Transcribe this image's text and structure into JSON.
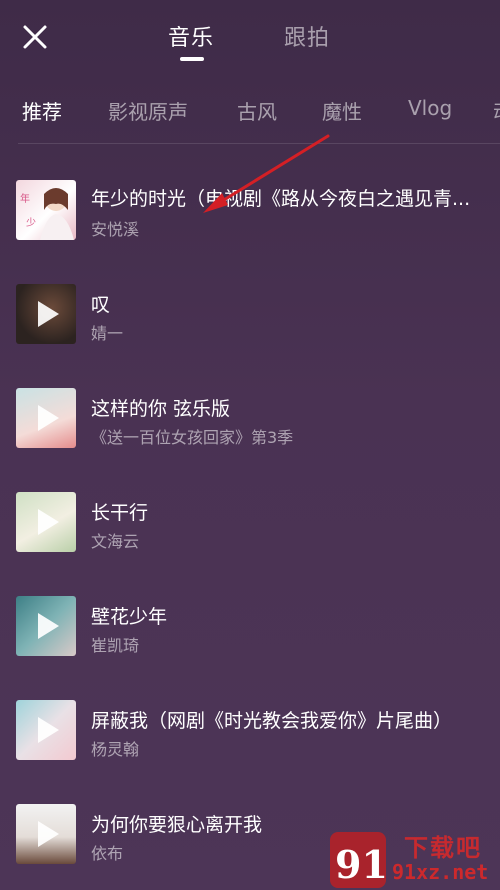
{
  "header": {
    "tabs": [
      {
        "label": "音乐",
        "active": true
      },
      {
        "label": "跟拍",
        "active": false
      }
    ]
  },
  "categories": [
    "推荐",
    "影视原声",
    "古风",
    "魔性",
    "Vlog",
    "动"
  ],
  "songs": [
    {
      "title": "年少的时光（电视剧《路从今夜白之遇见青...",
      "artist": "安悦溪",
      "thumb_colors": [
        "#f3d7de",
        "#ffffff"
      ],
      "play": false
    },
    {
      "title": "叹",
      "artist": "婧一",
      "thumb_colors": [
        "#2c2320",
        "#6b4a3a"
      ],
      "play": true
    },
    {
      "title": "这样的你 弦乐版",
      "artist": "《送一百位女孩回家》第3季",
      "thumb_colors": [
        "#c9e2e4",
        "#e58c8c"
      ],
      "play": true
    },
    {
      "title": "长干行",
      "artist": "文海云",
      "thumb_colors": [
        "#cfe0c4",
        "#f2efe2"
      ],
      "play": true
    },
    {
      "title": "壁花少年",
      "artist": "崔凯琦",
      "thumb_colors": [
        "#3d7f86",
        "#d9c9c8"
      ],
      "play": true
    },
    {
      "title": "屏蔽我（网剧《时光教会我爱你》片尾曲）",
      "artist": "杨灵翰",
      "thumb_colors": [
        "#9fd3da",
        "#f3c9d0"
      ],
      "play": true
    },
    {
      "title": "为何你要狠心离开我",
      "artist": "依布",
      "thumb_colors": [
        "#f2f2f2",
        "#6a4a3b"
      ],
      "play": true
    }
  ],
  "watermark": {
    "site": "下载吧",
    "url": "91xz.net",
    "logo": "91"
  },
  "colors": {
    "background": "#4a3253",
    "arrow": "#d41f25"
  }
}
